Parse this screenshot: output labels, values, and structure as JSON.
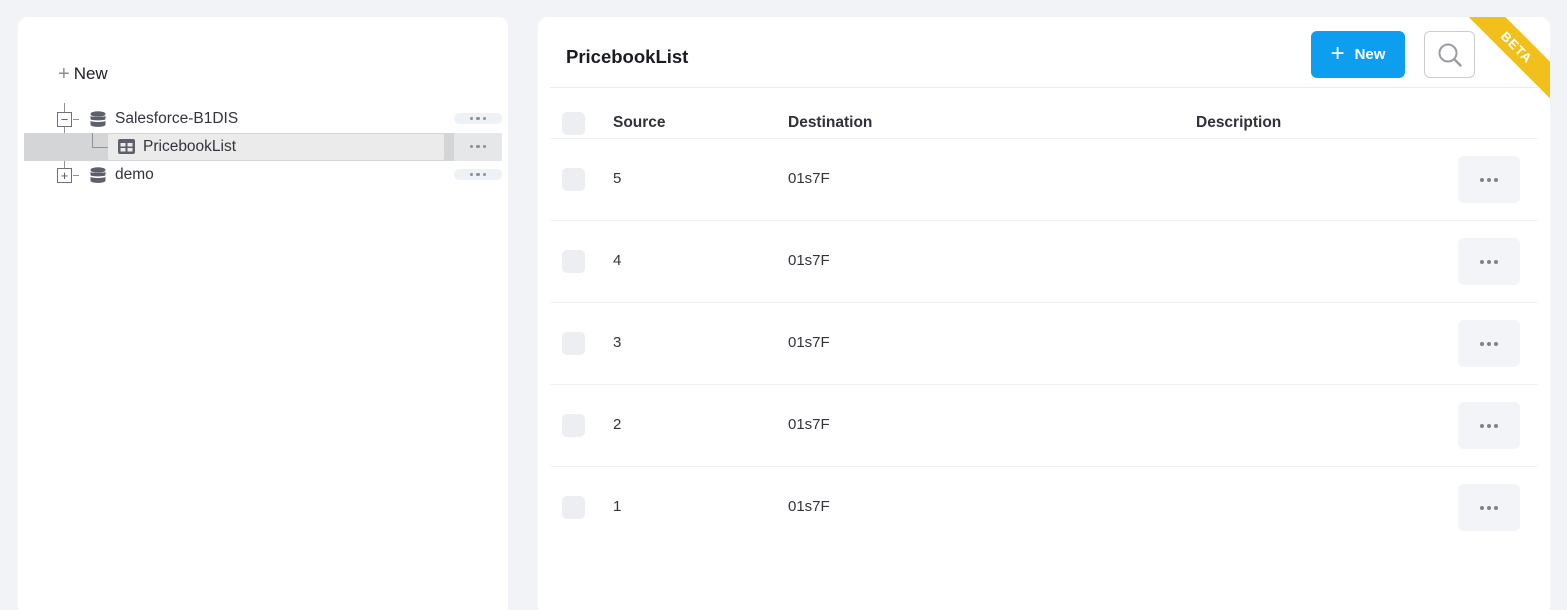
{
  "left_panel": {
    "new_label": "New",
    "tree": [
      {
        "label": "Salesforce-B1DIS",
        "type": "database",
        "expanded": true,
        "toggle": "−"
      },
      {
        "label": "PricebookList",
        "type": "table",
        "selected": true
      },
      {
        "label": "demo",
        "type": "database",
        "expanded": false,
        "toggle": "+"
      }
    ]
  },
  "main": {
    "title": "PricebookList",
    "new_button_label": "New",
    "search_button": "search-icon",
    "ribbon": "BETA",
    "columns": [
      "Source",
      "Destination",
      "Description"
    ],
    "rows": [
      {
        "source": "5",
        "destination": "01s7F",
        "description": ""
      },
      {
        "source": "4",
        "destination": "01s7F",
        "description": ""
      },
      {
        "source": "3",
        "destination": "01s7F",
        "description": ""
      },
      {
        "source": "2",
        "destination": "01s7F",
        "description": ""
      },
      {
        "source": "1",
        "destination": "01s7F",
        "description": ""
      }
    ]
  },
  "colors": {
    "primary": "#0d9ef0",
    "ribbon": "#f2c01d",
    "background": "#f1f3f7"
  }
}
